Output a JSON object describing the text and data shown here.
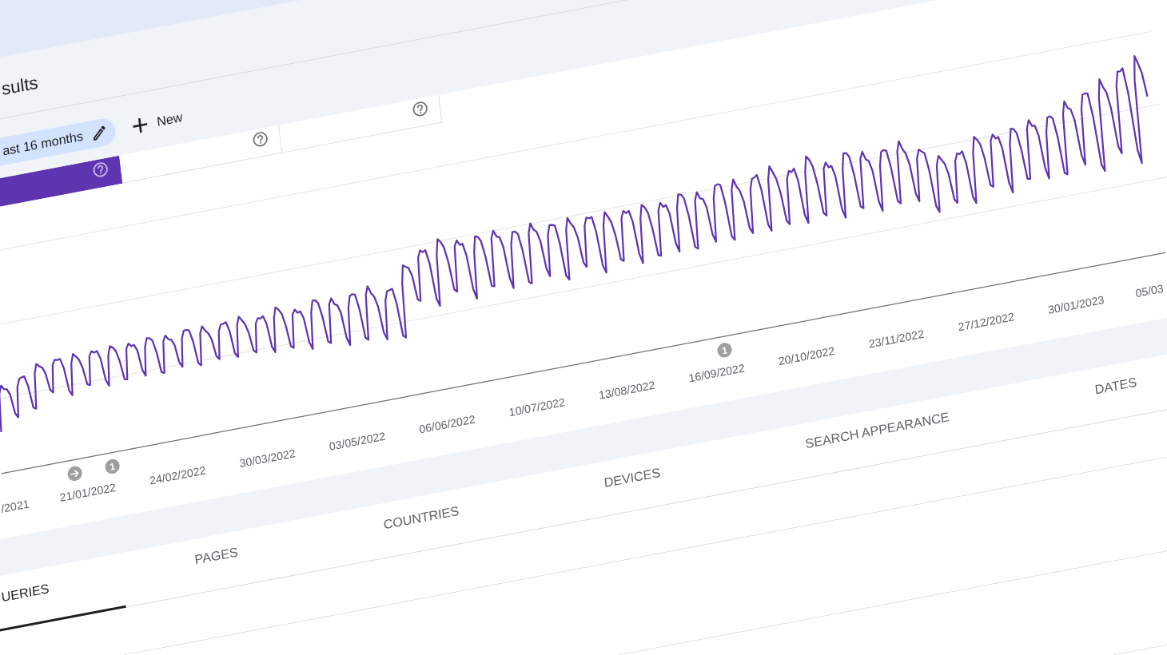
{
  "header": {
    "title": "sults"
  },
  "filters": {
    "date_chip": {
      "label": "ast 16 months"
    },
    "new_button": {
      "label": "New"
    }
  },
  "metric_tiles": [
    {
      "selected": true
    },
    {
      "selected": false
    },
    {
      "selected": false
    }
  ],
  "chart": {
    "x_axis_labels": [
      "/2021",
      "21/01/2022",
      "24/02/2022",
      "30/03/2022",
      "03/05/2022",
      "06/06/2022",
      "10/07/2022",
      "13/08/2022",
      "16/09/2022",
      "20/10/2022",
      "23/11/2022",
      "27/12/2022",
      "30/01/2023",
      "05/03"
    ],
    "annotations": [
      {
        "kind": "arrow"
      },
      {
        "kind": "count",
        "label": "1"
      },
      {
        "kind": "count",
        "label": "1"
      }
    ]
  },
  "tabs": [
    {
      "label": "UERIES",
      "selected": true
    },
    {
      "label": "PAGES",
      "selected": false
    },
    {
      "label": "COUNTRIES",
      "selected": false
    },
    {
      "label": "DEVICES",
      "selected": false
    },
    {
      "label": "SEARCH APPEARANCE",
      "selected": false
    },
    {
      "label": "DATES",
      "selected": false
    }
  ]
}
